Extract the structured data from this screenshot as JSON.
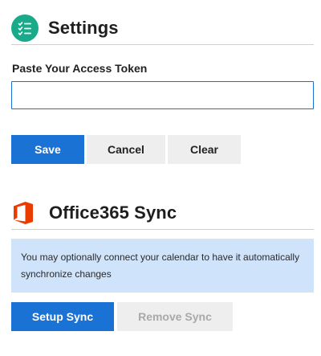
{
  "settings": {
    "title": "Settings",
    "icon": "checklist-icon",
    "icon_color": "#1aaa8a"
  },
  "token": {
    "label": "Paste Your Access Token",
    "value": "",
    "placeholder": ""
  },
  "actions": {
    "save_label": "Save",
    "cancel_label": "Cancel",
    "clear_label": "Clear"
  },
  "office": {
    "title": "Office365 Sync",
    "icon": "office-logo-icon",
    "icon_color": "#eb3c00",
    "info_text": "You may optionally connect your calendar to have it automatically synchronize changes",
    "setup_label": "Setup Sync",
    "remove_label": "Remove Sync",
    "remove_disabled": true
  },
  "colors": {
    "primary": "#1a72d4",
    "secondary_bg": "#eeeeee",
    "info_bg": "#cfe3fb",
    "input_border": "#1a6fd4"
  }
}
